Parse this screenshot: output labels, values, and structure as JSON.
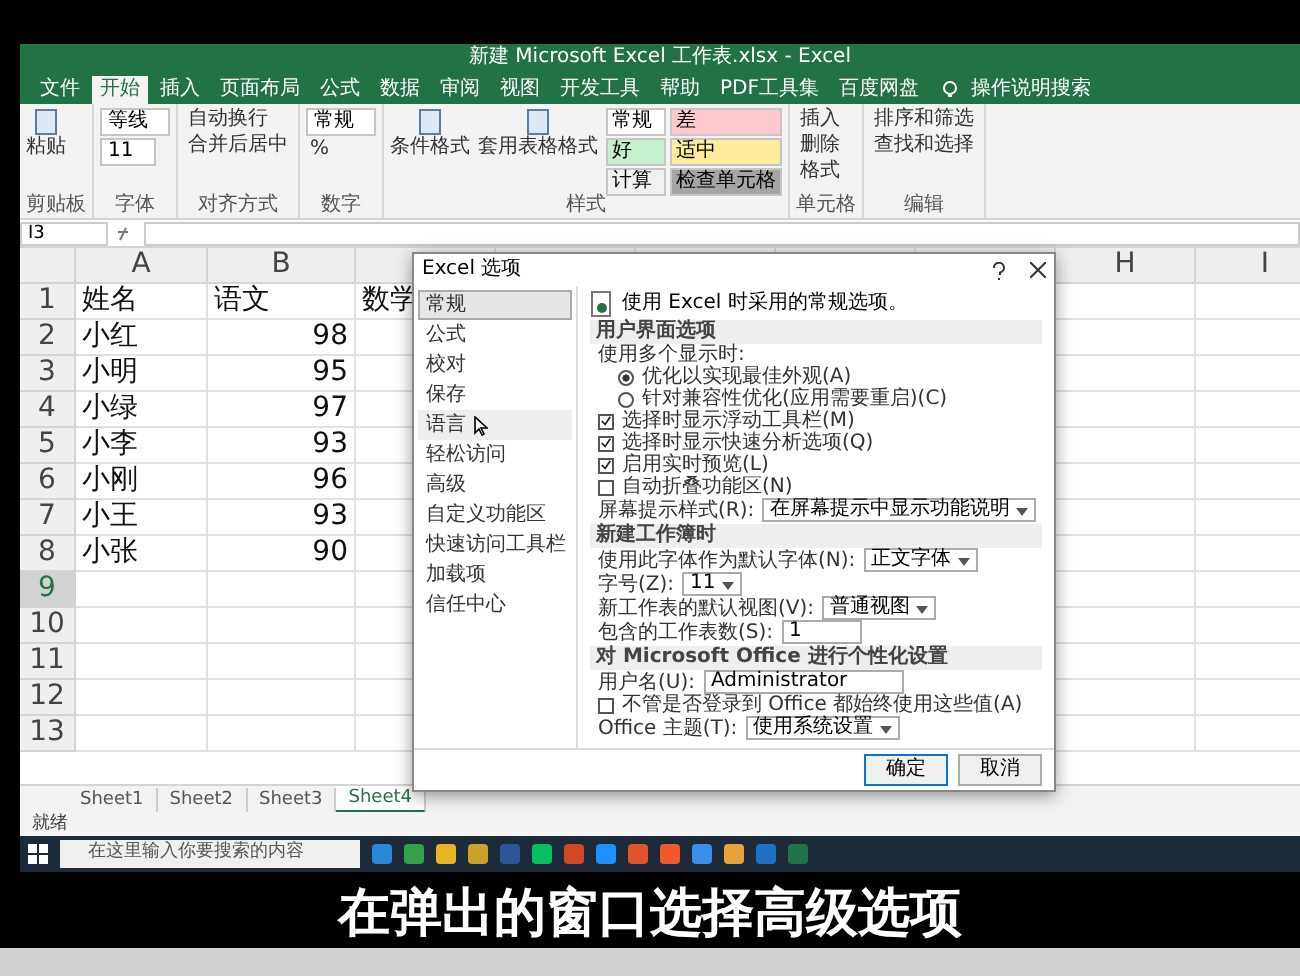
{
  "window": {
    "title": "新建 Microsoft Excel 工作表.xlsx - Excel"
  },
  "ribbon_tabs": [
    {
      "label": "文件",
      "selected": false
    },
    {
      "label": "开始",
      "selected": true
    },
    {
      "label": "插入",
      "selected": false
    },
    {
      "label": "页面布局",
      "selected": false
    },
    {
      "label": "公式",
      "selected": false
    },
    {
      "label": "数据",
      "selected": false
    },
    {
      "label": "审阅",
      "selected": false
    },
    {
      "label": "视图",
      "selected": false
    },
    {
      "label": "开发工具",
      "selected": false
    },
    {
      "label": "帮助",
      "selected": false
    },
    {
      "label": "PDF工具集",
      "selected": false
    },
    {
      "label": "百度网盘",
      "selected": false
    }
  ],
  "tell_me": "操作说明搜索",
  "ribbon_groups": [
    {
      "label": "剪贴板",
      "items": [
        {
          "kind": "big",
          "label": "粘贴"
        }
      ]
    },
    {
      "label": "字体",
      "items": [
        {
          "kind": "field",
          "label": "等线"
        },
        {
          "kind": "field",
          "label": "11"
        }
      ]
    },
    {
      "label": "对齐方式",
      "items": [
        {
          "kind": "small",
          "label": "自动换行"
        },
        {
          "kind": "small",
          "label": "合并后居中"
        }
      ]
    },
    {
      "label": "数字",
      "items": [
        {
          "kind": "field",
          "label": "常规"
        },
        {
          "kind": "small",
          "label": "%"
        }
      ]
    },
    {
      "label": "样式",
      "items": [
        {
          "kind": "big",
          "label": "条件格式"
        },
        {
          "kind": "big",
          "label": "套用表格格式"
        },
        {
          "kind": "swatch",
          "label": "常规",
          "color": "#ffffff"
        },
        {
          "kind": "swatch",
          "label": "差",
          "color": "#ffc7ce"
        },
        {
          "kind": "swatch",
          "label": "好",
          "color": "#c6efce"
        },
        {
          "kind": "swatch",
          "label": "适中",
          "color": "#ffeb9c"
        },
        {
          "kind": "swatch",
          "label": "计算",
          "color": "#f2f2f2"
        },
        {
          "kind": "swatch",
          "label": "检查单元格",
          "color": "#a5a5a5"
        }
      ]
    },
    {
      "label": "单元格",
      "items": [
        {
          "kind": "small",
          "label": "插入"
        },
        {
          "kind": "small",
          "label": "删除"
        },
        {
          "kind": "small",
          "label": "格式"
        }
      ]
    },
    {
      "label": "编辑",
      "items": [
        {
          "kind": "small",
          "label": "排序和筛选"
        },
        {
          "kind": "small",
          "label": "查找和选择"
        }
      ]
    }
  ],
  "name_box": "I3",
  "sheet": {
    "columns": [
      {
        "header": "A"
      },
      {
        "header": "B"
      },
      {},
      {},
      {},
      {},
      {},
      {
        "header": "H"
      },
      {
        "header": "I"
      }
    ],
    "rows": [
      {
        "number": "1",
        "selected": false,
        "cells": [
          {
            "kind": "text",
            "text": "姓名"
          },
          {
            "kind": "text",
            "text": "语文"
          },
          {
            "kind": "text",
            "text": "数学"
          }
        ]
      },
      {
        "number": "2",
        "selected": false,
        "cells": [
          {
            "kind": "text",
            "text": "小红"
          },
          {
            "kind": "number",
            "text": "98"
          }
        ]
      },
      {
        "number": "3",
        "selected": false,
        "cells": [
          {
            "kind": "text",
            "text": "小明"
          },
          {
            "kind": "number",
            "text": "95"
          }
        ]
      },
      {
        "number": "4",
        "selected": false,
        "cells": [
          {
            "kind": "text",
            "text": "小绿"
          },
          {
            "kind": "number",
            "text": "97"
          }
        ]
      },
      {
        "number": "5",
        "selected": false,
        "cells": [
          {
            "kind": "text",
            "text": "小李"
          },
          {
            "kind": "number",
            "text": "93"
          }
        ]
      },
      {
        "number": "6",
        "selected": false,
        "cells": [
          {
            "kind": "text",
            "text": "小刚"
          },
          {
            "kind": "number",
            "text": "96"
          }
        ]
      },
      {
        "number": "7",
        "selected": false,
        "cells": [
          {
            "kind": "text",
            "text": "小王"
          },
          {
            "kind": "number",
            "text": "93"
          }
        ]
      },
      {
        "number": "8",
        "selected": false,
        "cells": [
          {
            "kind": "text",
            "text": "小张"
          },
          {
            "kind": "number",
            "text": "90"
          }
        ]
      },
      {
        "number": "9",
        "selected": true,
        "cells": []
      },
      {
        "number": "10",
        "selected": false,
        "cells": []
      },
      {
        "number": "11",
        "selected": false,
        "cells": []
      },
      {
        "number": "12",
        "selected": false,
        "cells": []
      },
      {
        "number": "13",
        "selected": false,
        "cells": []
      }
    ]
  },
  "sheet_tabs": [
    {
      "label": "Sheet1",
      "selected": false
    },
    {
      "label": "Sheet2",
      "selected": false
    },
    {
      "label": "Sheet3",
      "selected": false
    },
    {
      "label": "Sheet4",
      "selected": true
    }
  ],
  "status": "就绪",
  "taskbar": {
    "search_placeholder": "在这里输入你要搜索的内容"
  },
  "dialog": {
    "title": "Excel 选项",
    "nav": [
      {
        "label": "常规",
        "selected": true,
        "hovered": false
      },
      {
        "label": "公式",
        "selected": false,
        "hovered": false
      },
      {
        "label": "校对",
        "selected": false,
        "hovered": false
      },
      {
        "label": "保存",
        "selected": false,
        "hovered": false
      },
      {
        "label": "语言",
        "selected": false,
        "hovered": true
      },
      {
        "label": "轻松访问",
        "selected": false,
        "hovered": false
      },
      {
        "label": "高级",
        "selected": false,
        "hovered": false
      },
      {
        "label": "自定义功能区",
        "selected": false,
        "hovered": false
      },
      {
        "label": "快速访问工具栏",
        "selected": false,
        "hovered": false
      },
      {
        "label": "加载项",
        "selected": false,
        "hovered": false
      },
      {
        "label": "信任中心",
        "selected": false,
        "hovered": false
      }
    ],
    "intro": "使用 Excel 时采用的常规选项。",
    "sections": [
      {
        "title": "用户界面选项",
        "items": [
          {
            "kind": "label",
            "label": "使用多个显示时:"
          },
          {
            "kind": "radio",
            "label": "优化以实现最佳外观(A)",
            "checked": true
          },
          {
            "kind": "radio",
            "label": "针对兼容性优化(应用需要重启)(C)",
            "checked": false
          },
          {
            "kind": "checkbox",
            "label": "选择时显示浮动工具栏(M)",
            "checked": true
          },
          {
            "kind": "checkbox",
            "label": "选择时显示快速分析选项(Q)",
            "checked": true
          },
          {
            "kind": "checkbox",
            "label": "启用实时预览(L)",
            "checked": true
          },
          {
            "kind": "checkbox",
            "label": "自动折叠功能区(N)",
            "checked": false
          },
          {
            "kind": "select",
            "label": "屏幕提示样式(R):",
            "value": "在屏幕提示中显示功能说明"
          }
        ]
      },
      {
        "title": "新建工作簿时",
        "items": [
          {
            "kind": "select",
            "label": "使用此字体作为默认字体(N):",
            "value": "正文字体"
          },
          {
            "kind": "select",
            "label": "字号(Z):",
            "value": "11"
          },
          {
            "kind": "select",
            "label": "新工作表的默认视图(V):",
            "value": "普通视图"
          },
          {
            "kind": "spin",
            "label": "包含的工作表数(S):",
            "value": "1"
          }
        ]
      },
      {
        "title": "对 Microsoft Office 进行个性化设置",
        "items": [
          {
            "kind": "input",
            "label": "用户名(U):",
            "value": "Administrator"
          },
          {
            "kind": "checkbox",
            "label": "不管是否登录到 Office 都始终使用这些值(A)",
            "checked": false
          },
          {
            "kind": "select",
            "label": "Office 主题(T):",
            "value": "使用系统设置"
          }
        ]
      }
    ],
    "buttons": [
      {
        "label": "确定",
        "default": true
      },
      {
        "label": "取消",
        "default": false
      }
    ]
  },
  "video": {
    "subtitle": "在弹出的窗口选择高级选项"
  }
}
